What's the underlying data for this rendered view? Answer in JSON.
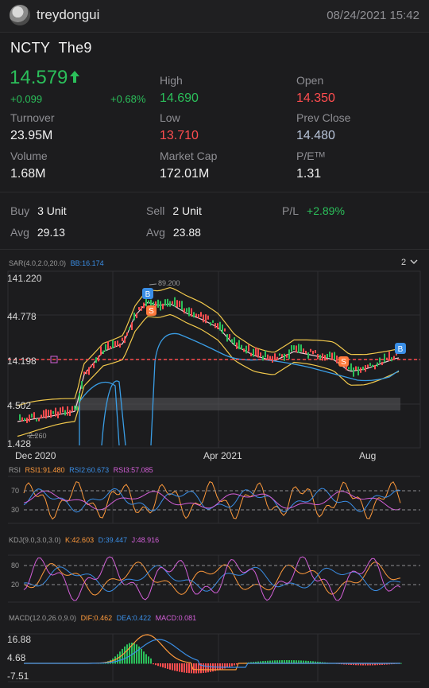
{
  "header": {
    "username": "treydongui",
    "datetime": "08/24/2021  15:42"
  },
  "stock": {
    "symbol": "NCTY",
    "name": "The9"
  },
  "quote": {
    "price": "14.579",
    "change": "+0.099",
    "change_pct": "+0.68%",
    "high_label": "High",
    "high": "14.690",
    "open_label": "Open",
    "open": "14.350",
    "turnover_label": "Turnover",
    "turnover": "23.95M",
    "low_label": "Low",
    "low": "13.710",
    "prev_close_label": "Prev Close",
    "prev_close": "14.480",
    "volume_label": "Volume",
    "volume": "1.68M",
    "market_cap_label": "Market Cap",
    "market_cap": "172.01M",
    "pe_label": "P/Eᵀᴹ",
    "pe": "1.31"
  },
  "position": {
    "buy_label": "Buy",
    "buy": "3 Unit",
    "sell_label": "Sell",
    "sell": "2 Unit",
    "pl_label": "P/L",
    "pl": "+2.89%",
    "avg_label": "Avg",
    "buy_avg": "29.13",
    "sell_avg": "23.88"
  },
  "main_chart": {
    "indicator_sar": "SAR(4.0,2.0,20.0)",
    "indicator_bb": "BB:16.174",
    "period_button": "2",
    "price_axis": [
      "141.220",
      "44.778",
      "14.198",
      "4.502",
      "1.428"
    ],
    "high_marker": "89.200",
    "low_marker": "2.260",
    "date_axis": [
      "Dec 2020",
      "Apr 2021",
      "Aug"
    ],
    "buy_marker": "B",
    "sell_marker": "S"
  },
  "rsi": {
    "label": "RSI",
    "rsi1": "RSI1:91.480",
    "rsi2": "RSI2:60.673",
    "rsi3": "RSI3:57.085",
    "levels": [
      "70",
      "30"
    ]
  },
  "kdj": {
    "label": "KDJ(9.0,3.0,3.0)",
    "k": "K:42.603",
    "d": "D:39.447",
    "j": "J:48.916",
    "levels": [
      "80",
      "20"
    ]
  },
  "macd": {
    "label": "MACD(12.0,26.0,9.0)",
    "dif": "DIF:0.462",
    "dea": "DEA:0.422",
    "macd": "MACD:0.081",
    "axis": [
      "16.88",
      "4.68",
      "-7.51"
    ]
  },
  "colors": {
    "up": "#2bbf5a",
    "down": "#ff4d4f",
    "accent_blue": "#3a8ee6",
    "orange": "#ff9a3c",
    "pink": "#d35fd8",
    "yellow": "#f2c94c"
  }
}
